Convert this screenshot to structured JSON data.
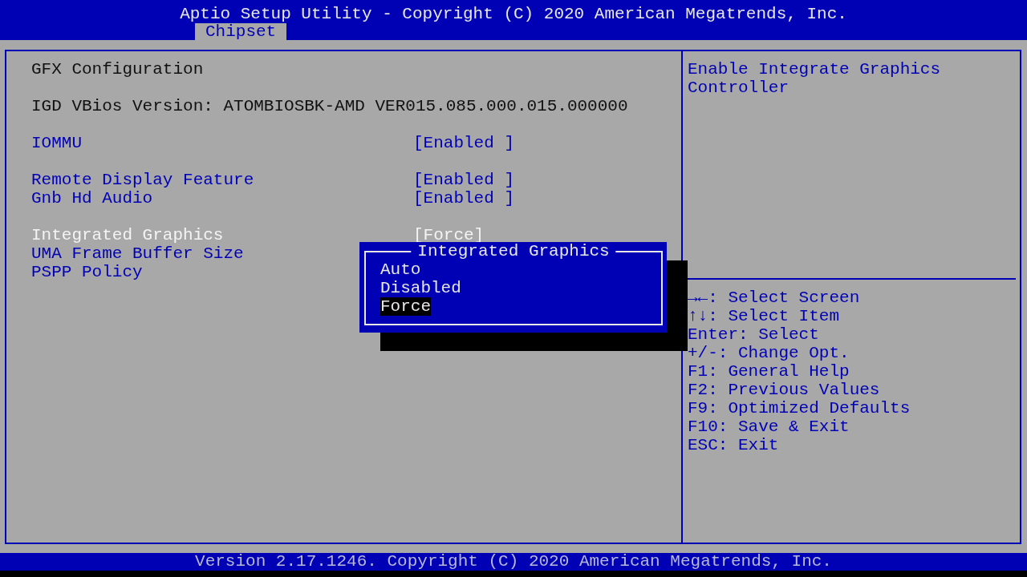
{
  "title": "Aptio Setup Utility - Copyright (C) 2020 American Megatrends, Inc.",
  "tabs": [
    {
      "label": "Chipset",
      "selected": true
    }
  ],
  "groups": [
    [
      {
        "kind": "text",
        "label": "GFX Configuration"
      }
    ],
    [
      {
        "kind": "text",
        "label": "IGD VBios Version: ATOMBIOSBK-AMD VER015.085.000.015.000000"
      }
    ],
    [
      {
        "kind": "setting",
        "label": "IOMMU",
        "value": "[Enabled ]",
        "selected": false
      }
    ],
    [
      {
        "kind": "setting",
        "label": "Remote Display Feature",
        "value": "[Enabled ]",
        "selected": false
      },
      {
        "kind": "setting",
        "label": "Gnb Hd Audio",
        "value": "[Enabled ]",
        "selected": false
      }
    ],
    [
      {
        "kind": "setting",
        "label": "Integrated Graphics",
        "value": "[Force]",
        "selected": true
      },
      {
        "kind": "setting",
        "label": "UMA Frame Buffer Size",
        "selected": false
      },
      {
        "kind": "setting",
        "label": "PSPP Policy",
        "selected": false
      }
    ]
  ],
  "popup": {
    "title": "Integrated Graphics",
    "options": [
      {
        "label": "Auto",
        "selected": false
      },
      {
        "label": "Disabled",
        "selected": false
      },
      {
        "label": "Force",
        "selected": true
      }
    ]
  },
  "help": "Enable Integrate Graphics Controller",
  "keys": [
    "→←: Select Screen",
    "↑↓: Select Item",
    "Enter: Select",
    "+/-: Change Opt.",
    "F1: General Help",
    "F2: Previous Values",
    "F9: Optimized Defaults",
    "F10: Save & Exit",
    "ESC: Exit"
  ],
  "footer": "Version 2.17.1246. Copyright (C) 2020 American Megatrends, Inc."
}
